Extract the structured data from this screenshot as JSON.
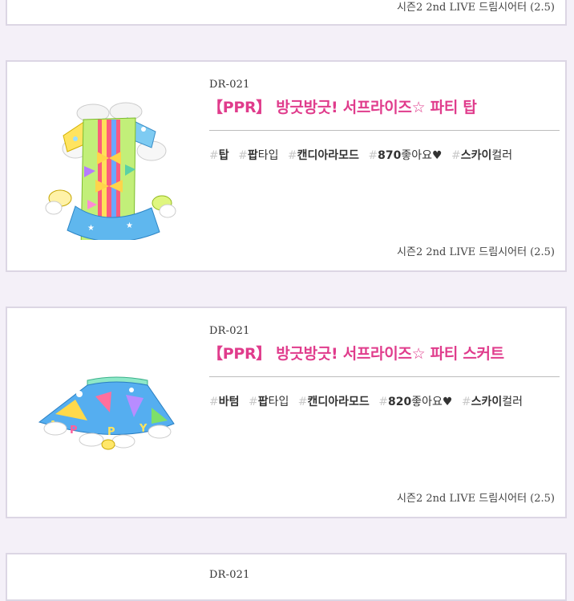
{
  "items": [
    {
      "source": "시즌2 2nd LIVE 드림시어터 (2.5)"
    },
    {
      "code": "DR-021",
      "title": "【PPR】 방긋방긋! 서프라이즈☆ 파티 탑",
      "tags": [
        {
          "hash": "#",
          "bold": "탑",
          "rest": ""
        },
        {
          "hash": "#",
          "bold": "팝",
          "rest": "타입"
        },
        {
          "hash": "#",
          "bold": "캔디아라모드",
          "rest": ""
        },
        {
          "hash": "#",
          "bold": "870",
          "rest": "좋아요♥"
        },
        {
          "hash": "#",
          "bold": "스카이",
          "rest": "컬러"
        }
      ],
      "source": "시즌2 2nd LIVE 드림시어터 (2.5)",
      "image_icon": "party-top-outfit-image"
    },
    {
      "code": "DR-021",
      "title": "【PPR】 방긋방긋! 서프라이즈☆ 파티 스커트",
      "tags": [
        {
          "hash": "#",
          "bold": "바텀",
          "rest": ""
        },
        {
          "hash": "#",
          "bold": "팝",
          "rest": "타입"
        },
        {
          "hash": "#",
          "bold": "캔디아라모드",
          "rest": ""
        },
        {
          "hash": "#",
          "bold": "820",
          "rest": "좋아요♥"
        },
        {
          "hash": "#",
          "bold": "스카이",
          "rest": "컬러"
        }
      ],
      "source": "시즌2 2nd LIVE 드림시어터 (2.5)",
      "image_icon": "party-skirt-outfit-image"
    },
    {
      "code": "DR-021"
    }
  ],
  "colors": {
    "title": "#e03c8c",
    "background": "#f4f0f8",
    "card_border": "#dcd6e4",
    "hash": "#c9c9c9"
  }
}
